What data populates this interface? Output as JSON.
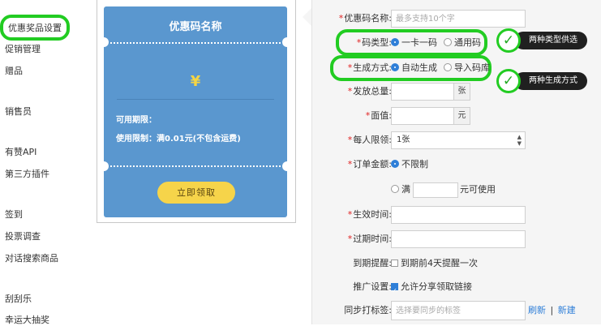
{
  "sidebar": {
    "items": [
      {
        "label": "优惠奖品设置",
        "active": true
      },
      {
        "label": "促销管理"
      },
      {
        "label": "赠品"
      },
      {
        "label": "销售员"
      },
      {
        "label": "有赞API"
      },
      {
        "label": "第三方插件"
      },
      {
        "label": "签到"
      },
      {
        "label": "投票调查"
      },
      {
        "label": "对话搜索商品"
      },
      {
        "label": "刮刮乐"
      },
      {
        "label": "幸运大抽奖"
      }
    ]
  },
  "preview": {
    "title": "优惠码名称",
    "currency_symbol": "¥",
    "validity_label": "可用期限：",
    "limit_text": "使用限制：满0.01元(不包含运费)",
    "claim_button": "立即领取"
  },
  "form": {
    "name": {
      "label": "优惠码名称:",
      "required": true,
      "placeholder": "最多支持10个字",
      "value": ""
    },
    "code_type": {
      "label": "码类型:",
      "required": true,
      "options": [
        "一卡一码",
        "通用码"
      ],
      "selected": "一卡一码"
    },
    "gen_method": {
      "label": "生成方式:",
      "required": true,
      "options": [
        "自动生成",
        "导入码库"
      ],
      "selected": "自动生成"
    },
    "total": {
      "label": "发放总量:",
      "required": true,
      "value": "",
      "unit": "张"
    },
    "face_value": {
      "label": "面值:",
      "required": true,
      "value": "",
      "unit": "元"
    },
    "per_user_limit": {
      "label": "每人限领:",
      "required": true,
      "value": "1张"
    },
    "order_amount": {
      "label": "订单金额:",
      "required": true,
      "option_unlimited": "不限制",
      "option_full_prefix": "满",
      "option_full_suffix": "元可使用",
      "selected": "不限制"
    },
    "start_time": {
      "label": "生效时间:",
      "required": true,
      "value": ""
    },
    "end_time": {
      "label": "过期时间:",
      "required": true,
      "value": ""
    },
    "expire_reminder": {
      "label": "到期提醒:",
      "required": false,
      "checkbox_label": "到期前4天提醒一次",
      "checked": false
    },
    "promotion": {
      "label": "推广设置:",
      "required": false,
      "checkbox_label": "允许分享领取链接",
      "checked": true
    },
    "sync_tags": {
      "label": "同步打标签:",
      "required": false,
      "placeholder": "选择要同步的标签",
      "refresh_link": "刷新",
      "separator": "|",
      "new_link": "新建"
    }
  },
  "annotations": [
    {
      "text": "两种类型供选"
    },
    {
      "text": "两种生成方式"
    }
  ],
  "colors": {
    "accent": "#2f7fd8",
    "highlight": "#22cc22",
    "coupon_bg": "#5a97cf",
    "claim_button_bg": "#f6d44a",
    "required": "#e02020"
  }
}
